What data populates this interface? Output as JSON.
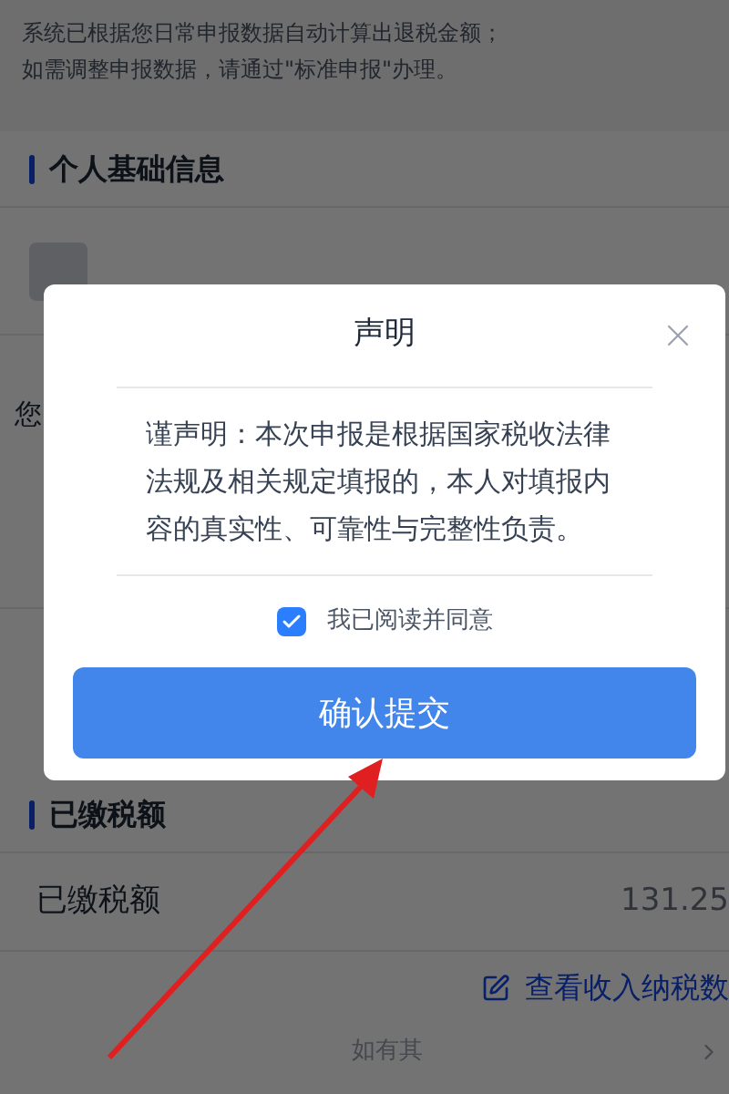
{
  "notice": [
    "系统已根据您日常申报数据自动计算出退税金额；",
    "如需调整申报数据，请通过\"标准申报\"办理。"
  ],
  "sections": [
    {
      "title": "个人基础信息",
      "rows": [
        {
          "kind": "avatar"
        },
        {
          "kind": "text",
          "label": "您"
        }
      ]
    },
    {
      "title": "已缴税额",
      "rows": [
        {
          "kind": "amount",
          "label": "已缴税额",
          "value": "131.25"
        }
      ]
    }
  ],
  "link": "查看收入纳税数",
  "footer": "如有其",
  "dialog": {
    "title": "声明",
    "body": "谨声明：本次申报是根据国家税收法律法规及相关规定填报的，本人对填报内容的真实性、可靠性与完整性负责。",
    "agree": {
      "label": "我已阅读并同意",
      "checked": true
    },
    "button": "确认提交"
  }
}
